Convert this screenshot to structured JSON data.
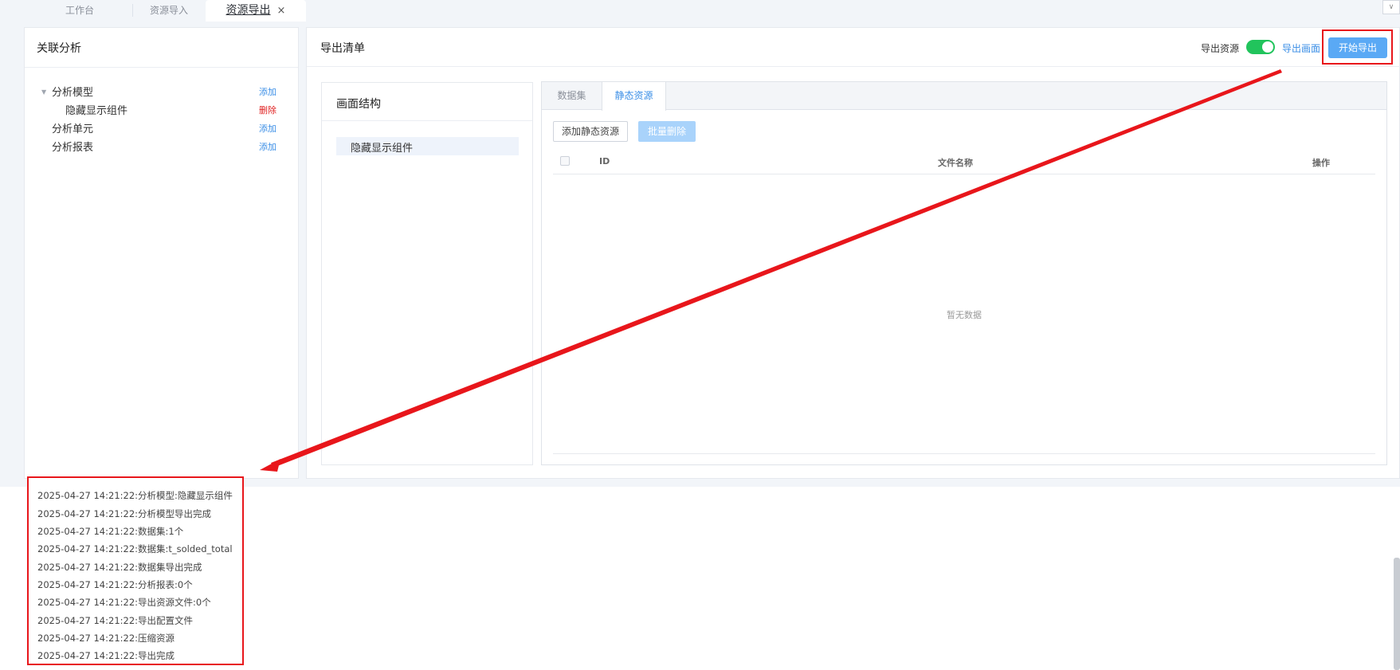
{
  "tabs": [
    {
      "label": "工作台"
    },
    {
      "label": "资源导入"
    },
    {
      "label": "资源导出",
      "close": "×"
    }
  ],
  "left_panel": {
    "title": "关联分析",
    "tree": [
      {
        "label": "分析模型",
        "action": "添加",
        "expanded": true
      },
      {
        "label": "隐藏显示组件",
        "action": "删除"
      },
      {
        "label": "分析单元",
        "action": "添加"
      },
      {
        "label": "分析报表",
        "action": "添加"
      }
    ]
  },
  "right_panel": {
    "title": "导出清单",
    "toggle_label": "导出资源",
    "toggle_on": true,
    "export_screen_link": "导出画面",
    "start_export_button": "开始导出",
    "structure": {
      "title": "画面结构",
      "item": "隐藏显示组件"
    },
    "resource_tabs": [
      {
        "label": "数据集"
      },
      {
        "label": "静态资源",
        "active": true
      }
    ],
    "add_static_button": "添加静态资源",
    "batch_delete_button": "批量删除",
    "table": {
      "columns": [
        "ID",
        "文件名称",
        "操作"
      ],
      "empty_text": "暂无数据"
    }
  },
  "log": [
    "2025-04-27 14:21:22:分析模型:隐藏显示组件",
    "2025-04-27 14:21:22:分析模型导出完成",
    "2025-04-27 14:21:22:数据集:1个",
    "2025-04-27 14:21:22:数据集:t_solded_total",
    "2025-04-27 14:21:22:数据集导出完成",
    "2025-04-27 14:21:22:分析报表:0个",
    "2025-04-27 14:21:22:导出资源文件:0个",
    "2025-04-27 14:21:22:导出配置文件",
    "2025-04-27 14:21:22:压缩资源",
    "2025-04-27 14:21:22:导出完成"
  ],
  "colors": {
    "accent": "#3a8ee6",
    "primary_button": "#5aa9f5",
    "toggle_on": "#21c45c",
    "annotation_red": "#e8161b",
    "delete_red": "#e02020"
  },
  "icons": [
    "close-icon",
    "chevron-down-icon",
    "caret-down-icon",
    "checkbox-icon",
    "annotation-arrow"
  ]
}
